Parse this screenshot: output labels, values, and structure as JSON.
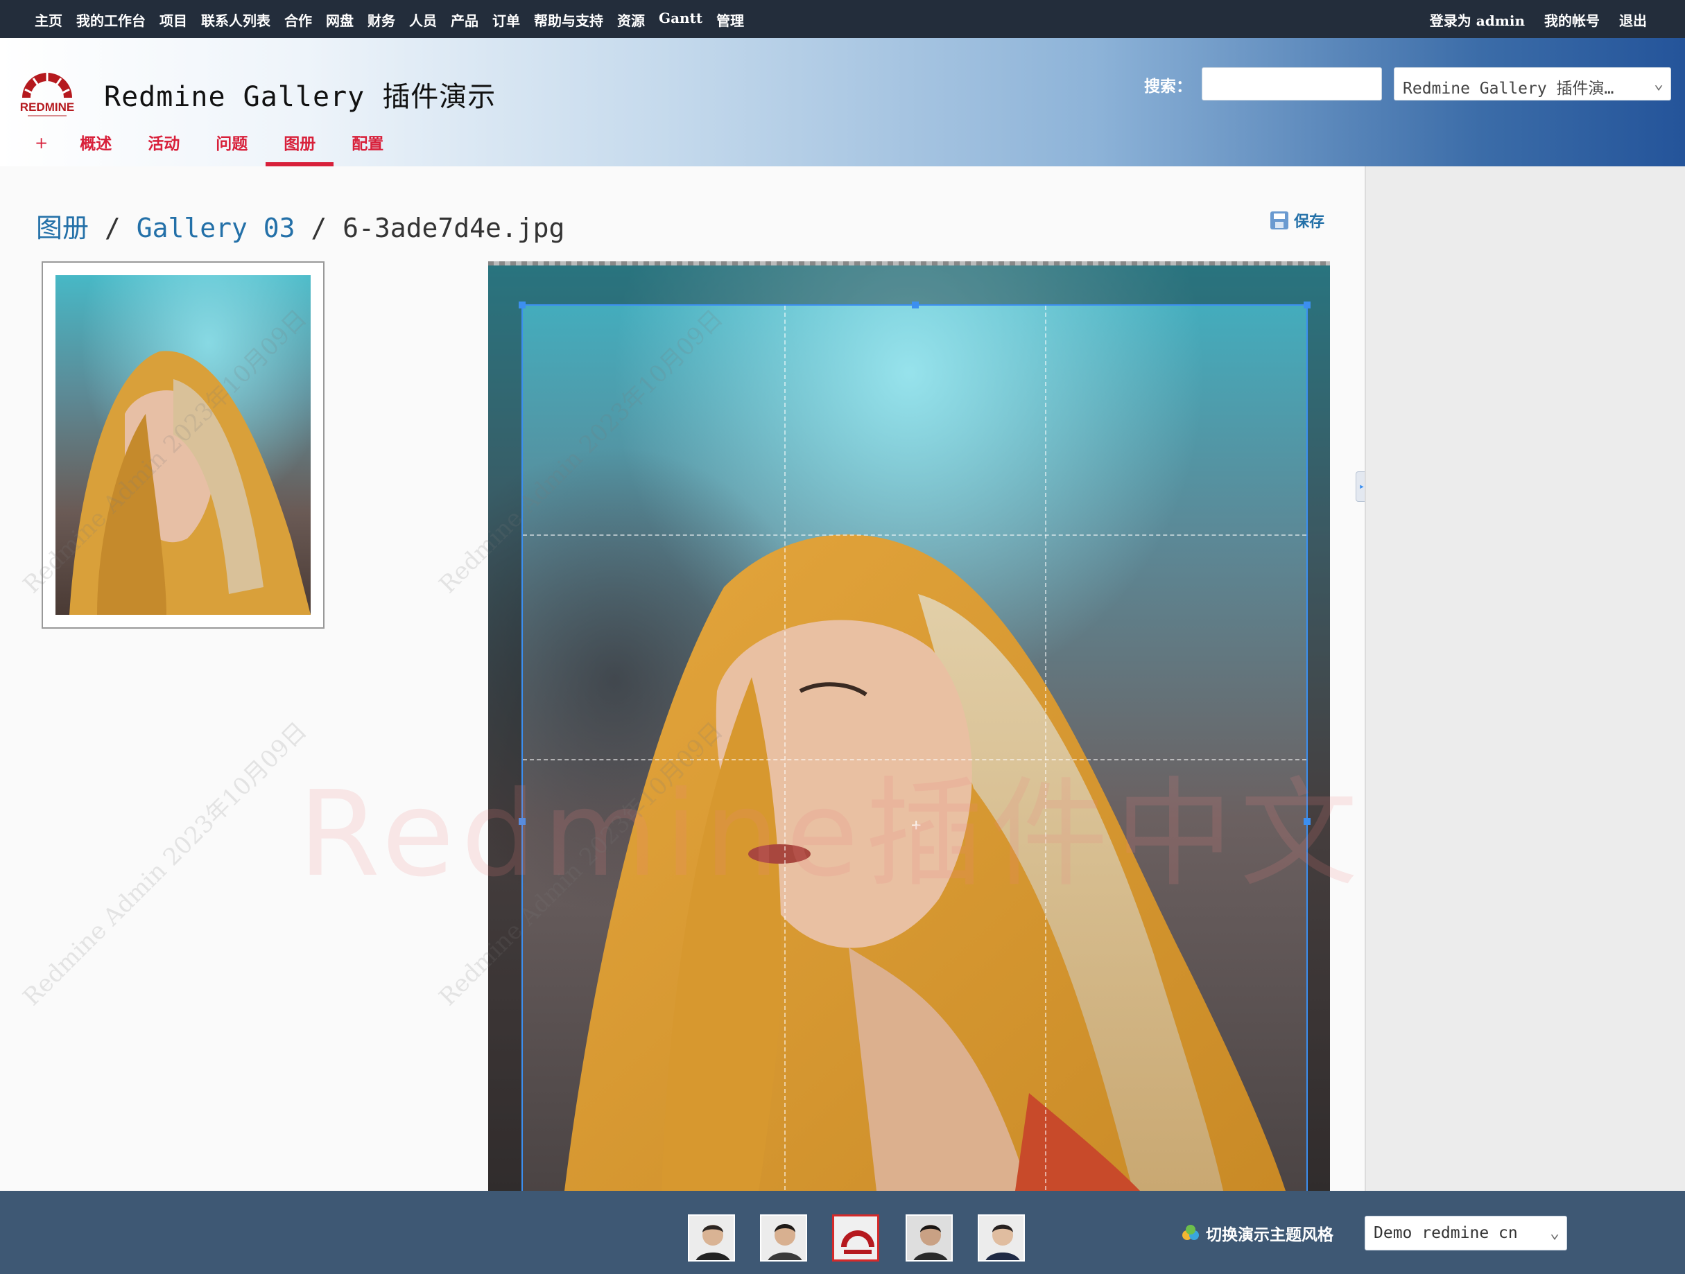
{
  "top_menu": {
    "left_items": [
      "主页",
      "我的工作台",
      "项目",
      "联系人列表",
      "合作",
      "网盘",
      "财务",
      "人员",
      "产品",
      "订单",
      "帮助与支持",
      "资源",
      "Gantt",
      "管理"
    ],
    "logged_in_as": "登录为",
    "username": "admin",
    "my_account": "我的帐号",
    "logout": "退出"
  },
  "header": {
    "logo_text": "REDMINE",
    "title": "Redmine Gallery 插件演示",
    "search_label": "搜索：",
    "search_value": "",
    "project_jump": "Redmine Gallery 插件演…"
  },
  "main_menu": {
    "plus": "+",
    "tabs": [
      "概述",
      "活动",
      "问题",
      "图册",
      "配置"
    ],
    "selected": "图册"
  },
  "breadcrumb": {
    "gallery": "图册",
    "sep": "/",
    "album": "Gallery 03",
    "file": "6-3ade7d4e.jpg"
  },
  "actions": {
    "save": "保存"
  },
  "watermark": {
    "big": "Redmine插件中文站",
    "small": "Redmine Admin 2023年10月09日"
  },
  "footer": {
    "theme_label": "切换演示主题风格",
    "theme_value": "Demo redmine cn"
  },
  "colors": {
    "accent_red": "#d8203a",
    "link_blue": "#2370a8",
    "top_bar": "#232d3b",
    "footer": "#3e5874",
    "crop_blue": "#3c8ff0"
  }
}
